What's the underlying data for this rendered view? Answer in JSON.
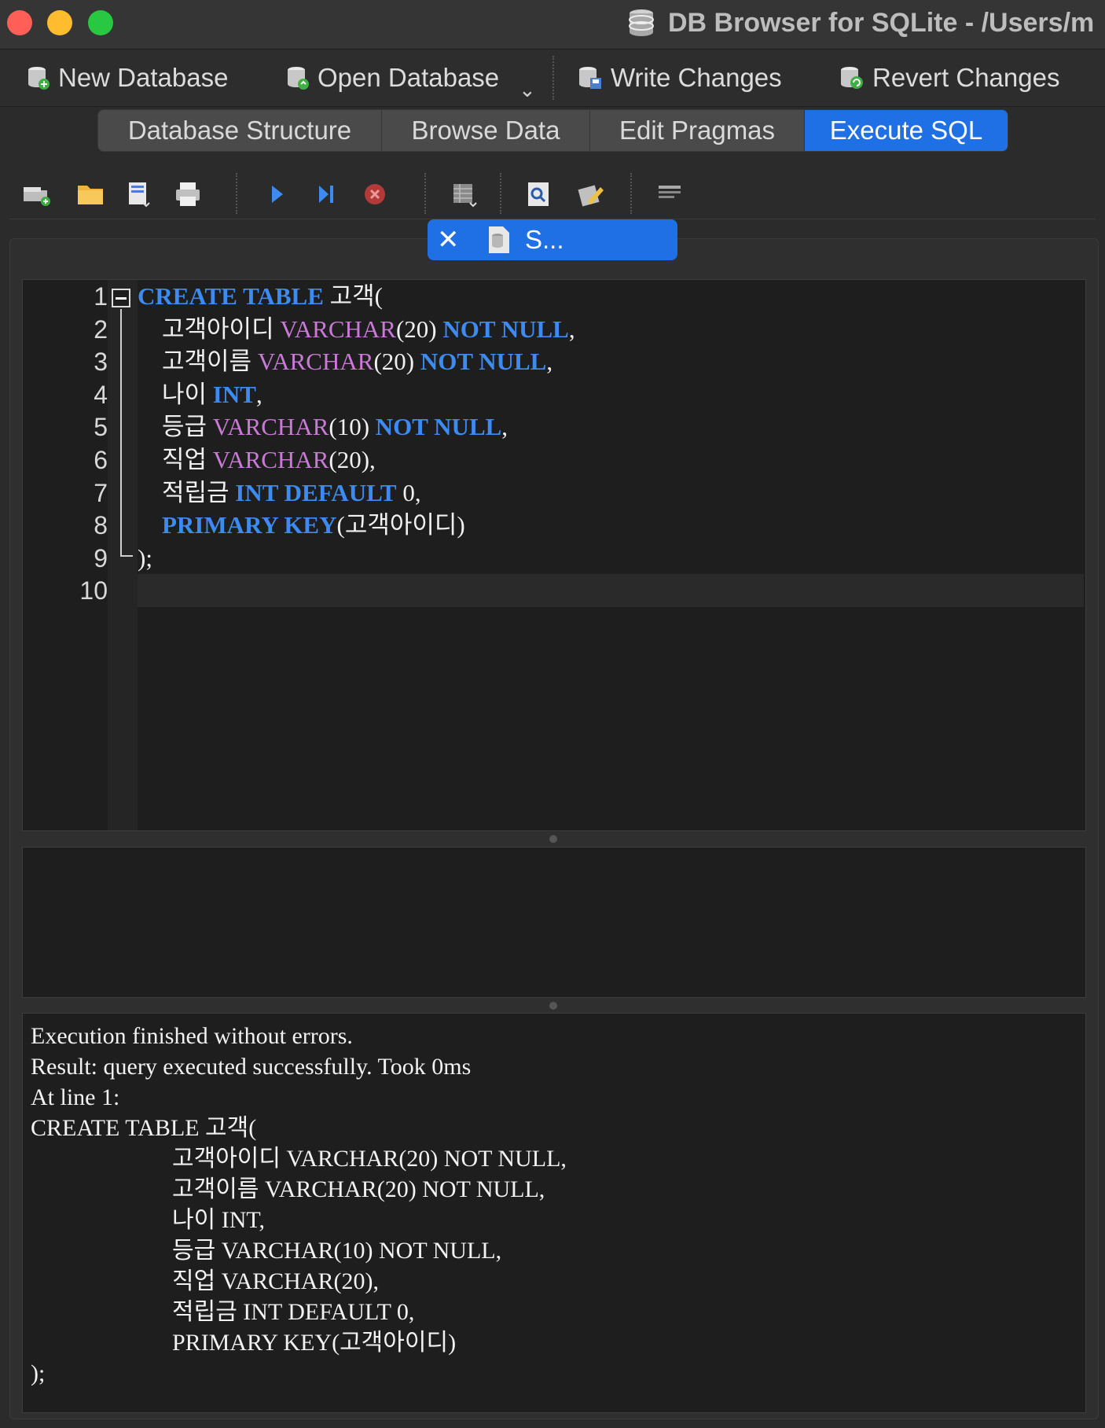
{
  "window": {
    "title": "DB Browser for SQLite - /Users/m"
  },
  "toolbar": {
    "new_database": "New Database",
    "open_database": "Open Database",
    "write_changes": "Write Changes",
    "revert_changes": "Revert Changes"
  },
  "tabs": [
    {
      "label": "Database Structure"
    },
    {
      "label": "Browse Data"
    },
    {
      "label": "Edit Pragmas"
    },
    {
      "label": "Execute SQL",
      "active": true
    }
  ],
  "sql_toolbar": {
    "icons": [
      "open-tab-icon",
      "open-sql-file-icon",
      "save-sql-file-icon",
      "print-icon",
      "execute-all-icon",
      "execute-current-line-icon",
      "stop-icon",
      "save-results-icon",
      "find-icon",
      "find-replace-icon",
      "comment-icon"
    ]
  },
  "editor": {
    "file_tab": "S...",
    "line_numbers": [
      "1",
      "2",
      "3",
      "4",
      "5",
      "6",
      "7",
      "8",
      "9",
      "10"
    ],
    "lines": [
      [
        {
          "t": "CREATE TABLE",
          "c": "kw"
        },
        {
          "t": " 고객("
        }
      ],
      [
        {
          "t": "    고객아이디 "
        },
        {
          "t": "VARCHAR",
          "c": "ty"
        },
        {
          "t": "(20) "
        },
        {
          "t": "NOT NULL",
          "c": "kw"
        },
        {
          "t": ","
        }
      ],
      [
        {
          "t": "    고객이름 "
        },
        {
          "t": "VARCHAR",
          "c": "ty"
        },
        {
          "t": "(20) "
        },
        {
          "t": "NOT NULL",
          "c": "kw"
        },
        {
          "t": ","
        }
      ],
      [
        {
          "t": "    나이 "
        },
        {
          "t": "INT",
          "c": "kw"
        },
        {
          "t": ","
        }
      ],
      [
        {
          "t": "    등급 "
        },
        {
          "t": "VARCHAR",
          "c": "ty"
        },
        {
          "t": "(10) "
        },
        {
          "t": "NOT NULL",
          "c": "kw"
        },
        {
          "t": ","
        }
      ],
      [
        {
          "t": "    직업 "
        },
        {
          "t": "VARCHAR",
          "c": "ty"
        },
        {
          "t": "(20),"
        }
      ],
      [
        {
          "t": "    적립금 "
        },
        {
          "t": "INT DEFAULT",
          "c": "kw"
        },
        {
          "t": " 0,"
        }
      ],
      [
        {
          "t": "    "
        },
        {
          "t": "PRIMARY KEY",
          "c": "kw"
        },
        {
          "t": "(고객아이디)"
        }
      ],
      [
        {
          "t": ");"
        }
      ],
      []
    ]
  },
  "messages": {
    "lines": [
      "Execution finished without errors.",
      "Result: query executed successfully. Took 0ms",
      "At line 1:",
      "CREATE TABLE 고객(",
      "                        고객아이디 VARCHAR(20) NOT NULL,",
      "                        고객이름 VARCHAR(20) NOT NULL,",
      "                        나이 INT,",
      "                        등급 VARCHAR(10) NOT NULL,",
      "                        직업 VARCHAR(20),",
      "                        적립금 INT DEFAULT 0,",
      "                        PRIMARY KEY(고객아이디)",
      ");"
    ]
  },
  "colors": {
    "accent": "#1f6fe5",
    "keyword": "#3d8bf0",
    "type": "#c97ad6",
    "background": "#1e1e1e"
  }
}
